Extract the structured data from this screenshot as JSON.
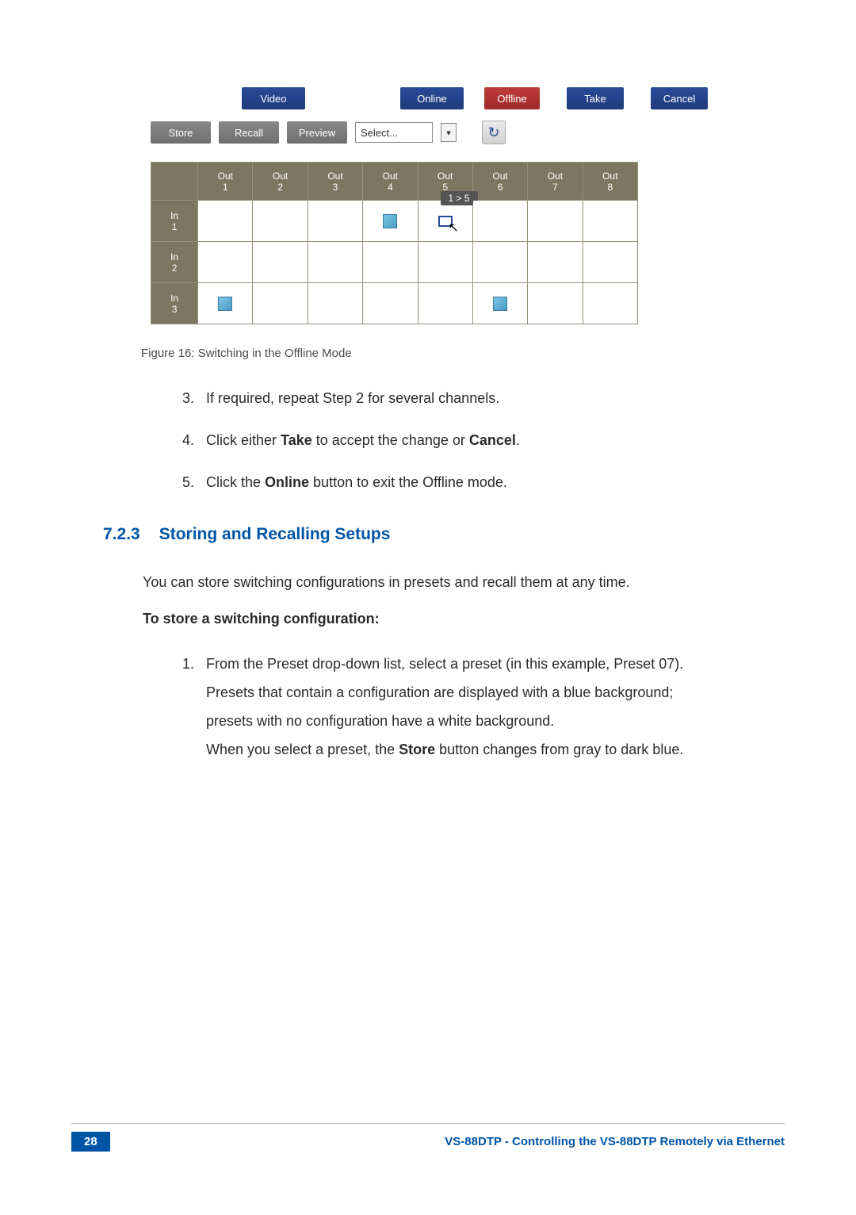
{
  "screenshot": {
    "row1": {
      "video": "Video",
      "online": "Online",
      "offline": "Offline",
      "take": "Take",
      "cancel": "Cancel"
    },
    "row2": {
      "store": "Store",
      "recall": "Recall",
      "preview": "Preview",
      "select_label": "Select...",
      "refresh_icon": "↻"
    },
    "matrix": {
      "cols": [
        "Out\n1",
        "Out\n2",
        "Out\n3",
        "Out\n4",
        "Out\n5",
        "Out\n6",
        "Out\n7",
        "Out\n8"
      ],
      "rows": [
        "In\n1",
        "In\n2",
        "In\n3"
      ],
      "tooltip": "1 > 5"
    }
  },
  "figcaption": "Figure 16: Switching in the Offline Mode",
  "steps_a": {
    "s3": "If required, repeat Step 2 for several channels.",
    "s4_pre": "Click either ",
    "s4_b1": "Take",
    "s4_mid": " to accept the change or ",
    "s4_b2": "Cancel",
    "s4_post": ".",
    "s5_pre": "Click the ",
    "s5_b": "Online",
    "s5_post": " button to exit the Offline mode."
  },
  "section": {
    "num": "7.2.3",
    "title": "Storing and Recalling Setups"
  },
  "intro": "You can store switching configurations in presets and recall them at any time.",
  "subhead": "To store a switching configuration:",
  "step1": {
    "l1": "From the Preset drop-down list, select a preset (in this example, Preset 07).",
    "l2": "Presets that contain a configuration are displayed with a blue background;",
    "l3": "presets with no configuration have a white background.",
    "l4_pre": "When you select a preset, the ",
    "l4_b": "Store",
    "l4_post": " button changes from gray to dark blue."
  },
  "footer": {
    "page": "28",
    "title": "VS-88DTP - Controlling the VS-88DTP Remotely via Ethernet"
  }
}
